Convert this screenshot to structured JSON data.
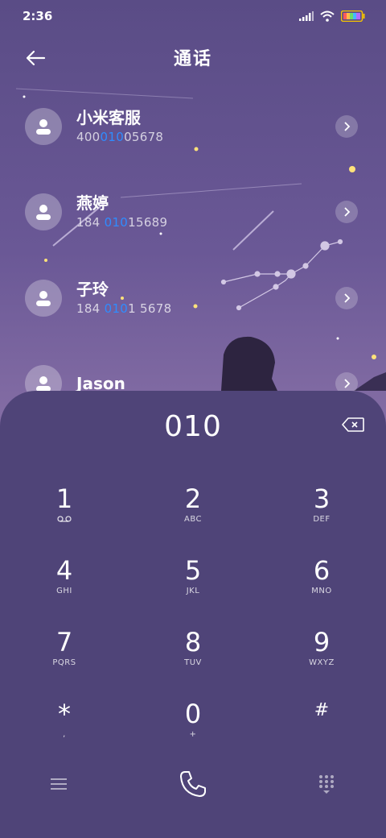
{
  "status_bar": {
    "time": "2:36"
  },
  "header": {
    "title": "通话"
  },
  "contacts": [
    {
      "name": "小米客服",
      "number_pre": "400",
      "number_match": "010",
      "number_post": "05678"
    },
    {
      "name": "燕婷",
      "number_pre": "184 ",
      "number_match": "010",
      "number_post": "15689"
    },
    {
      "name": "子玲",
      "number_pre": "184 ",
      "number_match": "010",
      "number_post": "1 5678"
    },
    {
      "name": "Jason",
      "number_pre": "",
      "number_match": "",
      "number_post": ""
    }
  ],
  "dialer": {
    "input": "010",
    "keys": [
      {
        "digit": "1",
        "letters": ""
      },
      {
        "digit": "2",
        "letters": "ABC"
      },
      {
        "digit": "3",
        "letters": "DEF"
      },
      {
        "digit": "4",
        "letters": "GHI"
      },
      {
        "digit": "5",
        "letters": "JKL"
      },
      {
        "digit": "6",
        "letters": "MNO"
      },
      {
        "digit": "7",
        "letters": "PQRS"
      },
      {
        "digit": "8",
        "letters": "TUV"
      },
      {
        "digit": "9",
        "letters": "WXYZ"
      },
      {
        "digit": "*",
        "letters": ","
      },
      {
        "digit": "0",
        "letters": "+"
      },
      {
        "digit": "#",
        "letters": ""
      }
    ]
  },
  "icons": {
    "back": "arrow-left-icon",
    "backspace": "backspace-icon",
    "voicemail": "voicemail-icon",
    "menu": "menu-icon",
    "call": "phone-icon",
    "keypad": "keypad-icon"
  },
  "colors": {
    "highlight": "#2f8cff",
    "panel": "#4f4478"
  }
}
